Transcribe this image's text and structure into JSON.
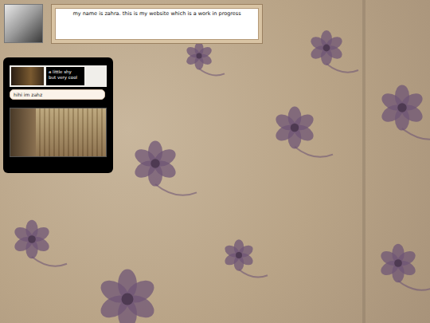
{
  "header": {
    "text": "my name is zahra. this is my website which is a work in progress"
  },
  "profile": {
    "caption": [
      "a little shy",
      "but very cool"
    ],
    "tagline": "hihi im zahz"
  }
}
